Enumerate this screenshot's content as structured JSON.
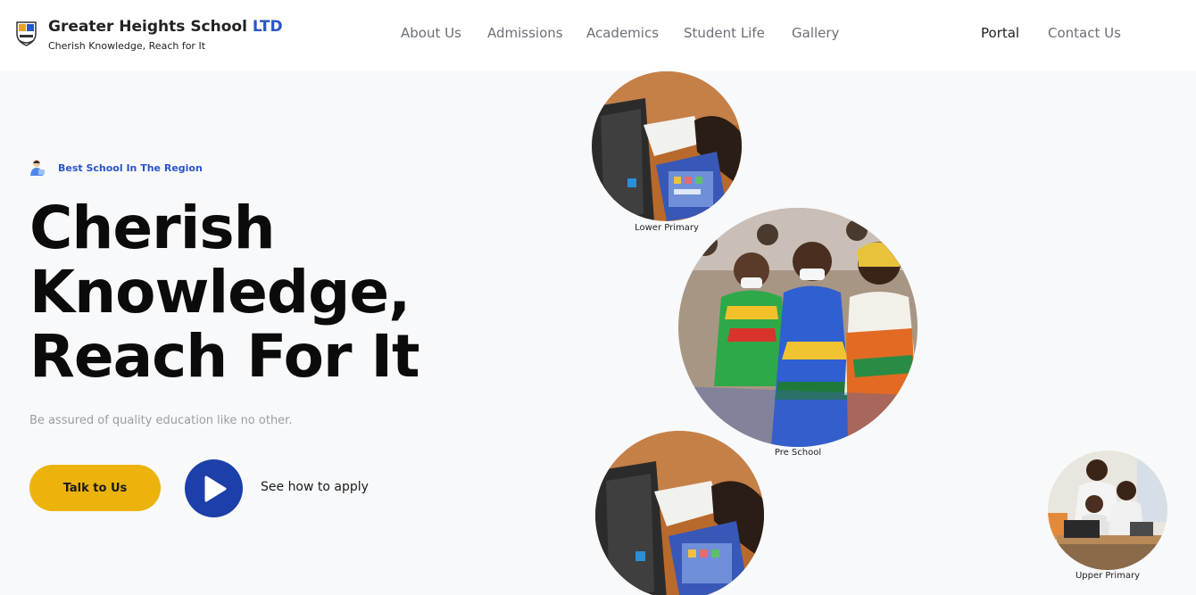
{
  "header": {
    "brand_name": "Greater Heights School",
    "brand_suffix": "LTD",
    "tagline": "Cherish Knowledge, Reach for It",
    "logo_icon": "school-crest-icon"
  },
  "nav": {
    "about": "About Us",
    "admissions": "Admissions",
    "academics": "Academics",
    "student_life": "Student Life",
    "gallery": "Gallery",
    "portal": "Portal",
    "contact": "Contact Us"
  },
  "hero": {
    "badge": "Best School In The Region",
    "title_line1": "Cherish",
    "title_line2": "Knowledge,",
    "title_line3": "Reach For It",
    "subtitle": "Be assured of quality education like no other.",
    "cta_label": "Talk to Us",
    "apply_label": "See how to apply"
  },
  "gallery": {
    "lower_primary": "Lower Primary",
    "pre_school": "Pre School",
    "upper_primary": "Upper Primary"
  },
  "colors": {
    "accent_yellow": "#ecb30c",
    "accent_blue": "#1d3faa",
    "brand_blue": "#2a55c8",
    "background": "#f8f9fb"
  }
}
